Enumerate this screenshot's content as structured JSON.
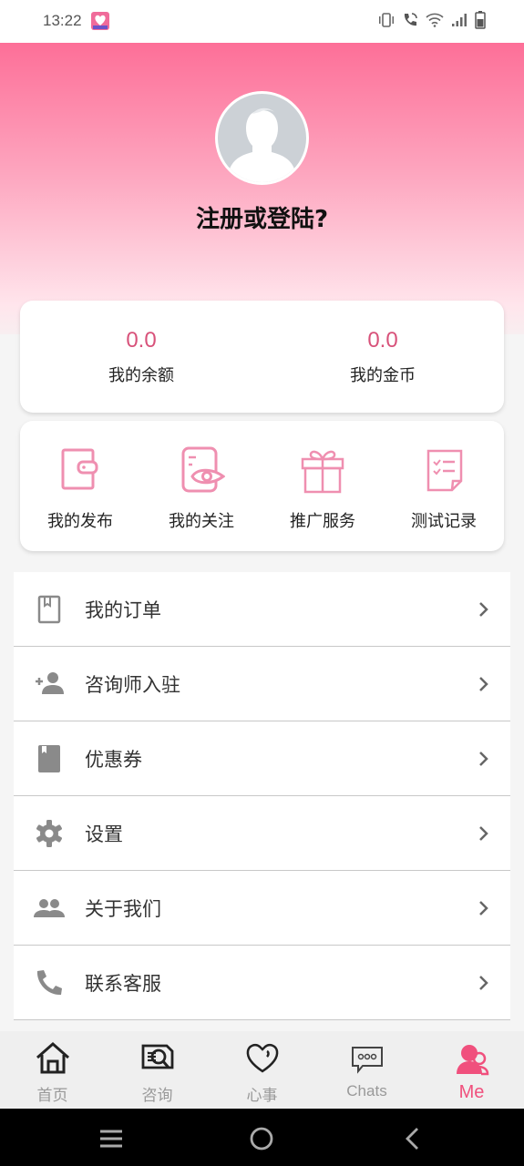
{
  "status_bar": {
    "time": "13:22",
    "icons": [
      "app-notification-icon",
      "vibrate-icon",
      "wifi-calling-icon",
      "wifi-icon",
      "signal-icon",
      "battery-icon"
    ]
  },
  "header": {
    "avatar": "default-avatar",
    "login_prompt": "注册或登陆?"
  },
  "balance": {
    "items": [
      {
        "value": "0.0",
        "label": "我的余额"
      },
      {
        "value": "0.0",
        "label": "我的金币"
      }
    ]
  },
  "quick_actions": {
    "items": [
      {
        "label": "我的发布",
        "icon": "wallet-icon"
      },
      {
        "label": "我的关注",
        "icon": "document-eye-icon"
      },
      {
        "label": "推广服务",
        "icon": "gift-icon"
      },
      {
        "label": "测试记录",
        "icon": "checklist-icon"
      }
    ]
  },
  "menu": {
    "items": [
      {
        "label": "我的订单",
        "icon": "book-outline-icon"
      },
      {
        "label": "咨询师入驻",
        "icon": "person-add-icon"
      },
      {
        "label": "优惠券",
        "icon": "book-filled-icon"
      },
      {
        "label": "设置",
        "icon": "gear-icon"
      },
      {
        "label": "关于我们",
        "icon": "people-icon"
      },
      {
        "label": "联系客服",
        "icon": "phone-icon"
      }
    ]
  },
  "tab_bar": {
    "tabs": [
      {
        "label": "首页",
        "icon": "home-icon",
        "active": false
      },
      {
        "label": "咨询",
        "icon": "consult-icon",
        "active": false
      },
      {
        "label": "心事",
        "icon": "heart-icon",
        "active": false
      },
      {
        "label": "Chats",
        "icon": "chat-bubble-icon",
        "active": false
      },
      {
        "label": "Me",
        "icon": "user-icon",
        "active": true
      }
    ]
  },
  "colors": {
    "accent": "#f0507d",
    "value_pink": "#d8527a",
    "icon_pink": "#ef8fb0",
    "icon_gray": "#8a8a8a"
  }
}
